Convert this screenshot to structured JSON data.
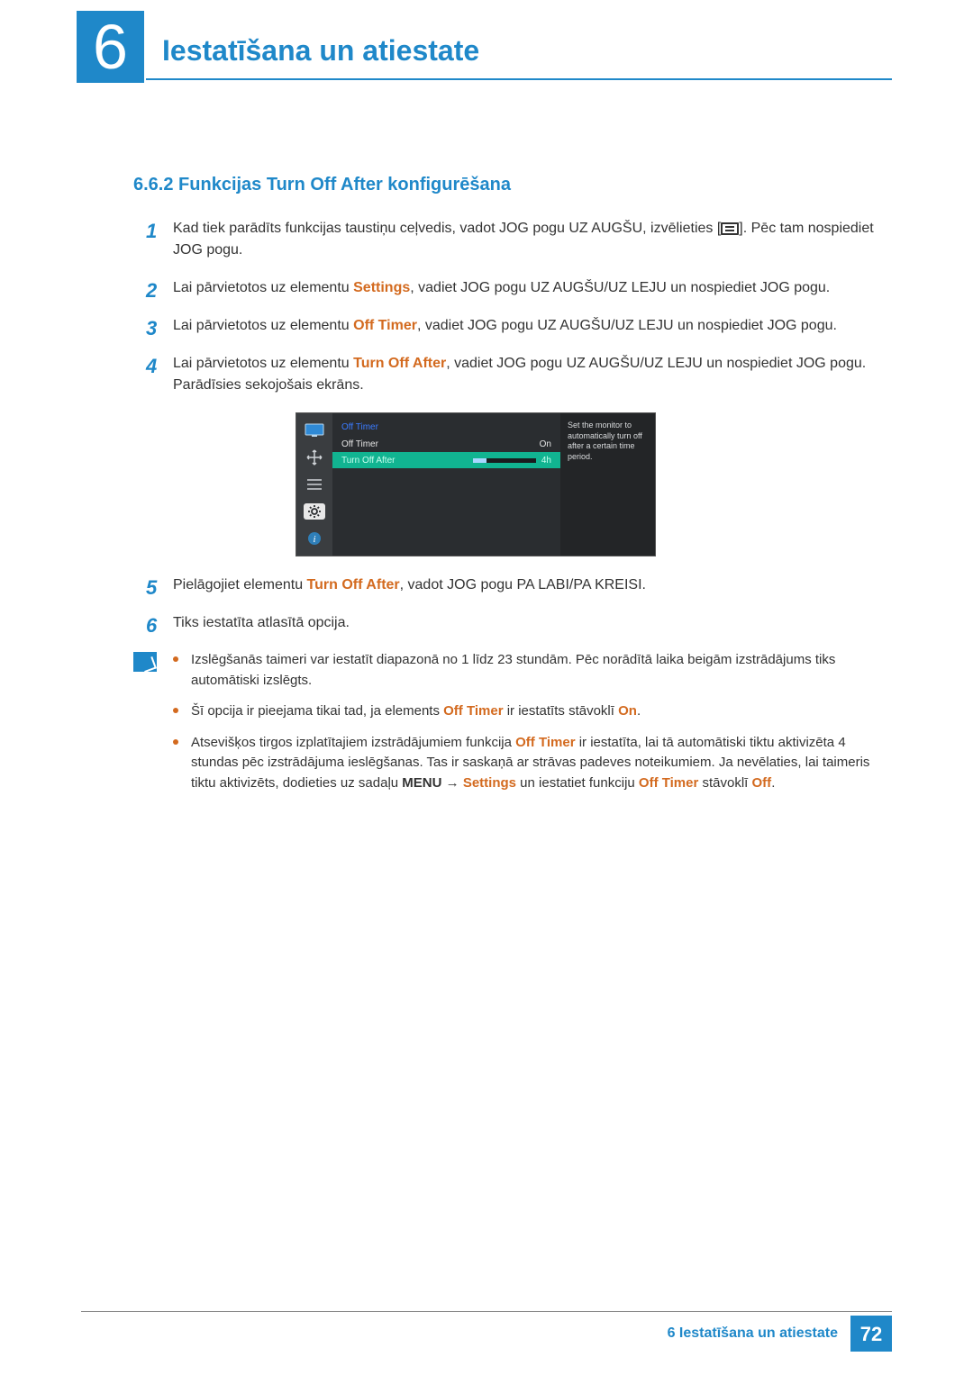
{
  "header": {
    "chapter_number": "6",
    "chapter_title": "Iestatīšana un atiestate"
  },
  "section": {
    "number": "6.6.2",
    "title": "Funkcijas Turn Off After konfigurēšana"
  },
  "steps": {
    "s1": {
      "n": "1",
      "a": "Kad tiek parādīts funkcijas taustiņu ceļvedis, vadot JOG pogu UZ AUGŠU, izvēlieties [",
      "b": "]. Pēc tam nospiediet JOG pogu."
    },
    "s2": {
      "n": "2",
      "a": "Lai pārvietotos uz elementu ",
      "hl": "Settings",
      "b": ", vadiet JOG pogu UZ AUGŠU/UZ LEJU un nospiediet JOG pogu."
    },
    "s3": {
      "n": "3",
      "a": "Lai pārvietotos uz elementu ",
      "hl": "Off Timer",
      "b": ", vadiet JOG pogu UZ AUGŠU/UZ LEJU un nospiediet JOG pogu."
    },
    "s4": {
      "n": "4",
      "a": "Lai pārvietotos uz elementu ",
      "hl": "Turn Off After",
      "b": ", vadiet JOG pogu UZ AUGŠU/UZ LEJU un nospiediet JOG pogu. Parādīsies sekojošais ekrāns."
    },
    "s5": {
      "n": "5",
      "a": "Pielāgojiet elementu ",
      "hl": "Turn Off After",
      "b": ", vadot JOG pogu PA LABI/PA KREISI."
    },
    "s6": {
      "n": "6",
      "a": "Tiks iestatīta atlasītā opcija."
    }
  },
  "osd": {
    "title": "Off Timer",
    "items": [
      {
        "label": "Off Timer",
        "value": "On"
      },
      {
        "label": "Turn Off After",
        "value": "4h"
      }
    ],
    "tip": "Set the monitor to automatically turn off after a certain time period."
  },
  "info": {
    "b1": "Izslēgšanās taimeri var iestatīt diapazonā no 1 līdz 23 stundām. Pēc norādītā laika beigām izstrādājums tiks automātiski izslēgts.",
    "b2_a": "Šī opcija ir pieejama tikai tad, ja elements ",
    "b2_hl1": "Off Timer",
    "b2_b": " ir iestatīts stāvoklī ",
    "b2_hl2": "On",
    "b2_c": ".",
    "b3_a": "Atsevišķos tirgos izplatītajiem izstrādājumiem funkcija ",
    "b3_hl1": "Off Timer",
    "b3_b": " ir iestatīta, lai tā automātiski tiktu aktivizēta 4 stundas pēc izstrādājuma ieslēgšanas. Tas ir saskaņā ar strāvas padeves noteikumiem. Ja nevēlaties, lai taimeris tiktu aktivizēts, dodieties uz sadaļu ",
    "b3_menu": "MENU",
    "b3_arrow": " → ",
    "b3_hl2": "Settings",
    "b3_c": " un iestatiet funkciju ",
    "b3_hl3": "Off Timer",
    "b3_d": " stāvoklī ",
    "b3_hl4": "Off",
    "b3_e": "."
  },
  "footer": {
    "text": "6 Iestatīšana un atiestate",
    "page": "72"
  }
}
